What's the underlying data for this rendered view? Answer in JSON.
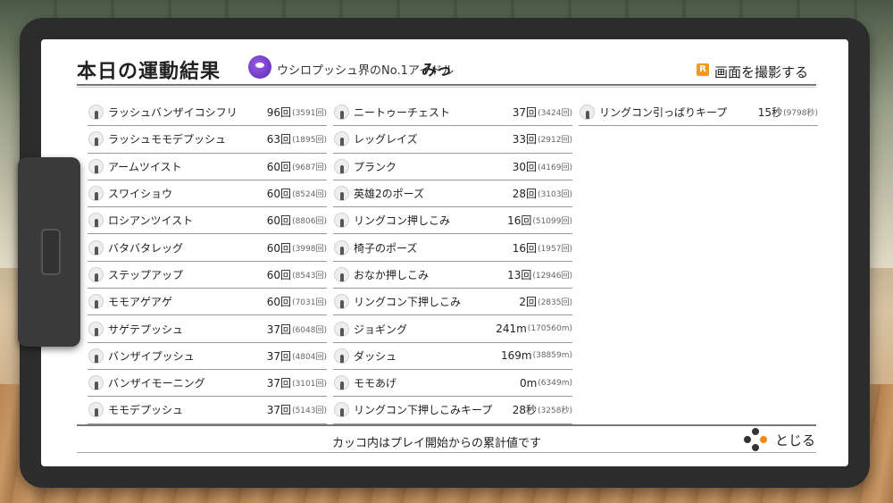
{
  "header": {
    "title": "本日の運動結果",
    "user_title": "ウシロプッシュ界のNo.1アイドル",
    "user_name": "みっ",
    "capture_key": "R",
    "capture_label": "画面を撮影する"
  },
  "columns": [
    [
      {
        "name": "ラッシュバンザイコシフリ",
        "count": "96回",
        "total": "(3591回)"
      },
      {
        "name": "ラッシュモモデプッシュ",
        "count": "63回",
        "total": "(1895回)"
      },
      {
        "name": "アームツイスト",
        "count": "60回",
        "total": "(9687回)"
      },
      {
        "name": "スワイショウ",
        "count": "60回",
        "total": "(8524回)"
      },
      {
        "name": "ロシアンツイスト",
        "count": "60回",
        "total": "(8806回)"
      },
      {
        "name": "バタバタレッグ",
        "count": "60回",
        "total": "(3998回)"
      },
      {
        "name": "ステップアップ",
        "count": "60回",
        "total": "(8543回)"
      },
      {
        "name": "モモアゲアゲ",
        "count": "60回",
        "total": "(7031回)"
      },
      {
        "name": "サゲテプッシュ",
        "count": "37回",
        "total": "(6048回)"
      },
      {
        "name": "バンザイプッシュ",
        "count": "37回",
        "total": "(4804回)"
      },
      {
        "name": "バンザイモーニング",
        "count": "37回",
        "total": "(3101回)"
      },
      {
        "name": "モモデプッシュ",
        "count": "37回",
        "total": "(5143回)"
      }
    ],
    [
      {
        "name": "ニートゥーチェスト",
        "count": "37回",
        "total": "(3424回)"
      },
      {
        "name": "レッグレイズ",
        "count": "33回",
        "total": "(2912回)"
      },
      {
        "name": "プランク",
        "count": "30回",
        "total": "(4169回)"
      },
      {
        "name": "英雄2のポーズ",
        "count": "28回",
        "total": "(3103回)"
      },
      {
        "name": "リングコン押しこみ",
        "count": "16回",
        "total": "(51099回)"
      },
      {
        "name": "椅子のポーズ",
        "count": "16回",
        "total": "(1957回)"
      },
      {
        "name": "おなか押しこみ",
        "count": "13回",
        "total": "(12946回)"
      },
      {
        "name": "リングコン下押しこみ",
        "count": "2回",
        "total": "(2835回)"
      },
      {
        "name": "ジョギング",
        "count": "241m",
        "total": "(170560m)"
      },
      {
        "name": "ダッシュ",
        "count": "169m",
        "total": "(38859m)"
      },
      {
        "name": "モモあげ",
        "count": "0m",
        "total": "(6349m)"
      },
      {
        "name": "リングコン下押しこみキープ",
        "count": "28秒",
        "total": "(3258秒)"
      }
    ],
    [
      {
        "name": "リングコン引っぱりキープ",
        "count": "15秒",
        "total": "(9798秒)"
      }
    ]
  ],
  "footer": {
    "note": "カッコ内はプレイ開始からの累計値です",
    "close_label": "とじる"
  }
}
